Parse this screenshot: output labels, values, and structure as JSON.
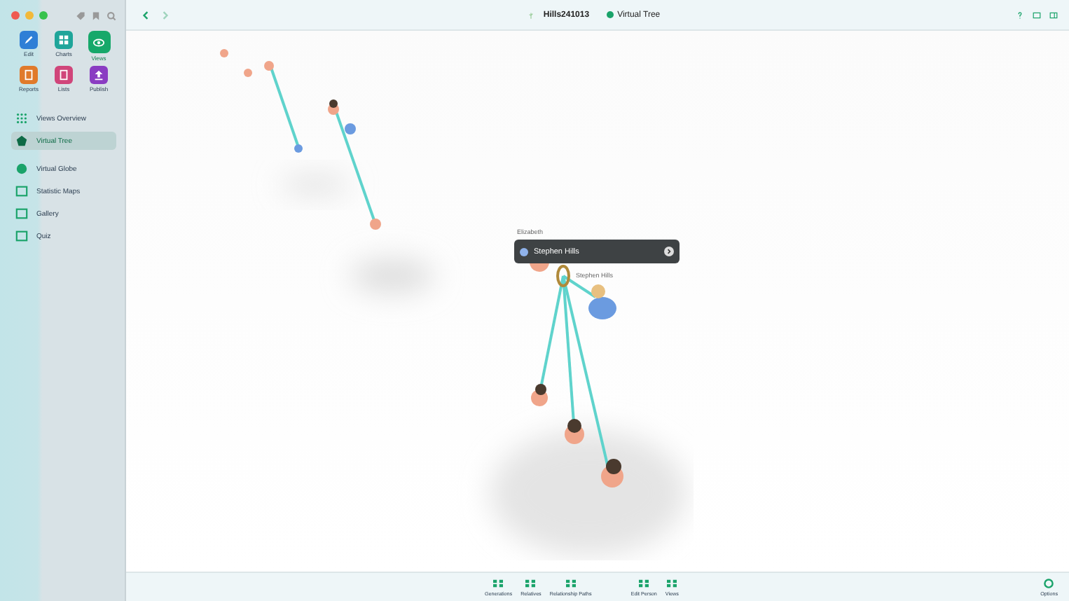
{
  "sidebar": {
    "tiles": [
      {
        "label": "Edit",
        "color": "#2f7fd6",
        "selected": false
      },
      {
        "label": "Charts",
        "color": "#1fa59a",
        "selected": false
      },
      {
        "label": "Views",
        "color": "#16a86a",
        "selected": true
      },
      {
        "label": "Reports",
        "color": "#e07a2a",
        "selected": false
      },
      {
        "label": "Lists",
        "color": "#d0457a",
        "selected": false
      },
      {
        "label": "Publish",
        "color": "#8a3cc2",
        "selected": false
      }
    ],
    "items": [
      {
        "label": "Views Overview",
        "selected": false
      },
      {
        "label": "Virtual Tree",
        "selected": true
      },
      {
        "label": "Virtual Globe",
        "selected": false
      },
      {
        "label": "Statistic Maps",
        "selected": false
      },
      {
        "label": "Gallery",
        "selected": false
      },
      {
        "label": "Quiz",
        "selected": false
      }
    ]
  },
  "top_bar": {
    "title": "Hills241013",
    "view": "Virtual Tree"
  },
  "canvas": {
    "above_label": "Elizabeth",
    "popup": "Stephen Hills",
    "person_label": "Stephen Hills"
  },
  "bottom_toolbar": {
    "items": [
      "Generations",
      "Relatives",
      "Relationship Paths",
      "Edit Person",
      "Views"
    ],
    "options": "Options"
  }
}
